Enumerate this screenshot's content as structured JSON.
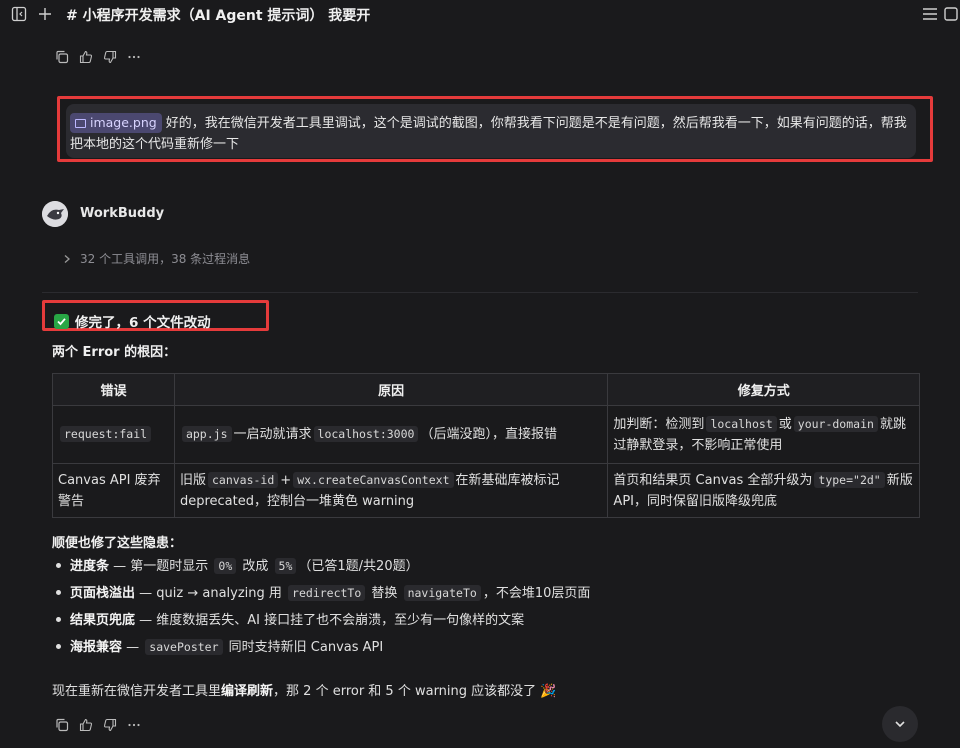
{
  "header": {
    "title": "# 小程序开发需求（AI Agent 提示词） 我要开"
  },
  "user_message": {
    "attachment": "image.png",
    "text": "好的，我在微信开发者工具里调试，这个是调试的截图，你帮我看下问题是不是有问题，然后帮我看一下，如果有问题的话，帮我把本地的这个代码重新修一下"
  },
  "assistant": {
    "name": "WorkBuddy",
    "tool_summary": "32 个工具调用，38 条过程消息",
    "status": "修完了，6 个文件改动",
    "root_cause_heading": "两个 Error 的根因：",
    "table": {
      "headers": [
        "错误",
        "原因",
        "修复方式"
      ],
      "rows": [
        {
          "error_code": "request:fail",
          "cause": {
            "c1": "app.js",
            "t1": "一启动就请求",
            "c2": "localhost:3000",
            "t2": "（后端没跑），直接报错"
          },
          "fix": {
            "t1": "加判断：检测到",
            "c1": "localhost",
            "t2": "或",
            "c2": "your-domain",
            "t3": "就跳过静默登录，不影响正常使用"
          }
        },
        {
          "error_text": "Canvas API 废弃警告",
          "cause": {
            "t0": "旧版",
            "c1": "canvas-id",
            "t1": "+",
            "c2": "wx.createCanvasContext",
            "t2": "在新基础库被标记 deprecated，控制台一堆黄色 warning"
          },
          "fix": {
            "t1": "首页和结果页 Canvas 全部升级为",
            "c1": "type=\"2d\"",
            "t2": "新版 API，同时保留旧版降级兜底"
          }
        }
      ]
    },
    "also_heading": "顺便也修了这些隐患：",
    "fixes": [
      {
        "title": "进度条",
        "t1": " — 第一题时显示 ",
        "c1": "0%",
        "t2": " 改成 ",
        "c2": "5%",
        "t3": "（已答1题/共20题）"
      },
      {
        "title": "页面栈溢出",
        "t1": " — quiz → analyzing 用 ",
        "c1": "redirectTo",
        "t2": " 替换 ",
        "c2": "navigateTo",
        "t3": "，不会堆10层页面"
      },
      {
        "title": "结果页兜底",
        "t1": " — 维度数据丢失、AI 接口挂了也不会崩溃，至少有一句像样的文案",
        "c1": "",
        "t2": "",
        "c2": "",
        "t3": ""
      },
      {
        "title": "海报兼容",
        "t1": " — ",
        "c1": "savePoster",
        "t2": " 同时支持新旧 Canvas API",
        "c2": "",
        "t3": ""
      }
    ],
    "final": {
      "t1": "现在重新在微信开发者工具里",
      "b1": "编译刷新",
      "t2": "，那 2 个 error 和 5 个 warning 应该都没了 🎉"
    }
  },
  "icons": [
    "sidebar-toggle-icon",
    "plus-icon",
    "menu-icon",
    "window-icon",
    "copy-icon",
    "thumbs-up-icon",
    "thumbs-down-icon",
    "more-icon",
    "chevron-right-icon",
    "chevron-down-icon",
    "check-icon"
  ],
  "colors": {
    "background": "#1a1a1c",
    "highlight": "#e53b3b",
    "success": "#28a745",
    "attachment": "#4b4870"
  }
}
